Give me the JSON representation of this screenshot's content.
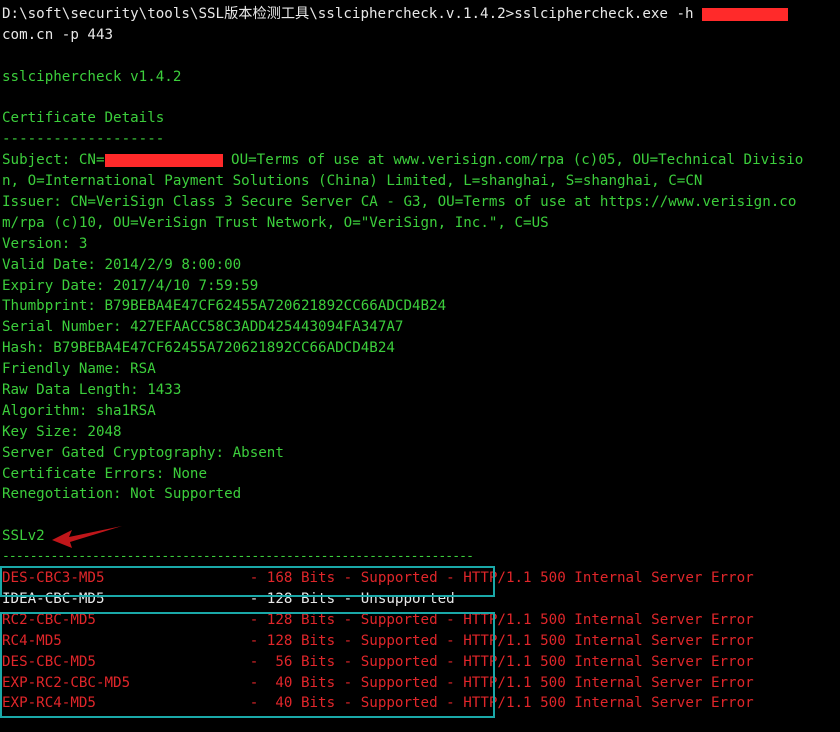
{
  "command": {
    "path": "D:\\soft\\security\\tools\\SSL版本检测工具\\sslciphercheck.v.1.4.2>sslciphercheck.exe -h ",
    "host_suffix": "com.cn -p 443"
  },
  "version_line": "sslciphercheck v1.4.2",
  "cert_heading": "Certificate Details",
  "cert_rule": "-------------------",
  "subject": {
    "prefix": "Subject: CN=",
    "rest_line1": " OU=Terms of use at www.verisign.com/rpa (c)05, OU=Technical Divisio",
    "line2": "n, O=International Payment Solutions (China) Limited, L=shanghai, S=shanghai, C=CN"
  },
  "issuer": {
    "line1": "Issuer: CN=VeriSign Class 3 Secure Server CA - G3, OU=Terms of use at https://www.verisign.co",
    "line2": "m/rpa (c)10, OU=VeriSign Trust Network, O=\"VeriSign, Inc.\", C=US"
  },
  "details": [
    "Version: 3",
    "Valid Date: 2014/2/9 8:00:00",
    "Expiry Date: 2017/4/10 7:59:59",
    "Thumbprint: B79BEBA4E47CF62455A720621892CC66ADCD4B24",
    "Serial Number: 427EFAACC58C3ADD425443094FA347A7",
    "Hash: B79BEBA4E47CF62455A720621892CC66ADCD4B24",
    "Friendly Name: RSA",
    "Raw Data Length: 1433",
    "Algorithm: sha1RSA",
    "Key Size: 2048",
    "Server Gated Cryptography: Absent",
    "Certificate Errors: None",
    "Renegotiation: Not Supported"
  ],
  "ssl_heading": "SSLv2",
  "ssl_rule": "--------------------------------------------------------------------",
  "ciphers": [
    {
      "text": "DES-CBC3-MD5                 - 168 Bits - Supported - HTTP/1.1 500 Internal Server Error",
      "status": "supported"
    },
    {
      "text": "IDEA-CBC-MD5                 - 128 Bits - Unsupported",
      "status": "unsupported"
    },
    {
      "text": "RC2-CBC-MD5                  - 128 Bits - Supported - HTTP/1.1 500 Internal Server Error",
      "status": "supported"
    },
    {
      "text": "RC4-MD5                      - 128 Bits - Supported - HTTP/1.1 500 Internal Server Error",
      "status": "supported"
    },
    {
      "text": "DES-CBC-MD5                  -  56 Bits - Supported - HTTP/1.1 500 Internal Server Error",
      "status": "supported"
    },
    {
      "text": "EXP-RC2-CBC-MD5              -  40 Bits - Supported - HTTP/1.1 500 Internal Server Error",
      "status": "supported"
    },
    {
      "text": "EXP-RC4-MD5                  -  40 Bits - Supported - HTTP/1.1 500 Internal Server Error",
      "status": "supported"
    }
  ],
  "colors": {
    "background": "#000000",
    "text_normal": "#3cce3c",
    "text_command": "#e8e8e8",
    "text_supported": "#e0262a",
    "redaction": "#ff2a2a",
    "highlight_box": "#1aa8a8",
    "arrow": "#c0161a"
  }
}
